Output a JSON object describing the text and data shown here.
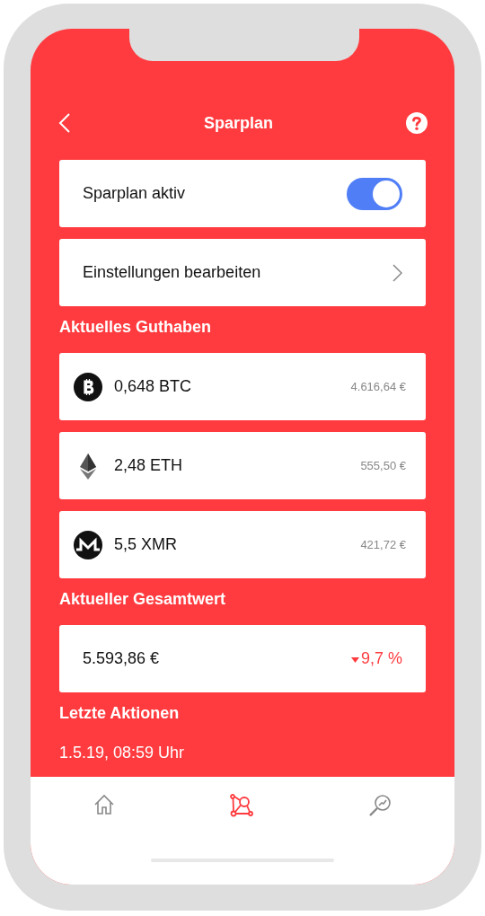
{
  "header": {
    "title": "Sparplan"
  },
  "toggle_row": {
    "label": "Sparplan aktiv",
    "on": true
  },
  "settings_row": {
    "label": "Einstellungen bearbeiten"
  },
  "balance": {
    "heading": "Aktuelles Guthaben",
    "coins": [
      {
        "kind": "btc",
        "amount": "0,648 BTC",
        "value": "4.616,64 €"
      },
      {
        "kind": "eth",
        "amount": "2,48 ETH",
        "value": "555,50 €"
      },
      {
        "kind": "xmr",
        "amount": "5,5 XMR",
        "value": "421,72 €"
      }
    ]
  },
  "total": {
    "heading": "Aktueller Gesamtwert",
    "value": "5.593,86 €",
    "falling": true,
    "change": "9,7 %"
  },
  "actions": {
    "heading": "Letzte Aktionen",
    "items": [
      {
        "date": "1.5.19, 08:59 Uhr"
      }
    ]
  },
  "nav": [
    {
      "kind": "home",
      "selected": false
    },
    {
      "kind": "portfolio",
      "selected": true
    },
    {
      "kind": "search",
      "selected": false
    }
  ]
}
